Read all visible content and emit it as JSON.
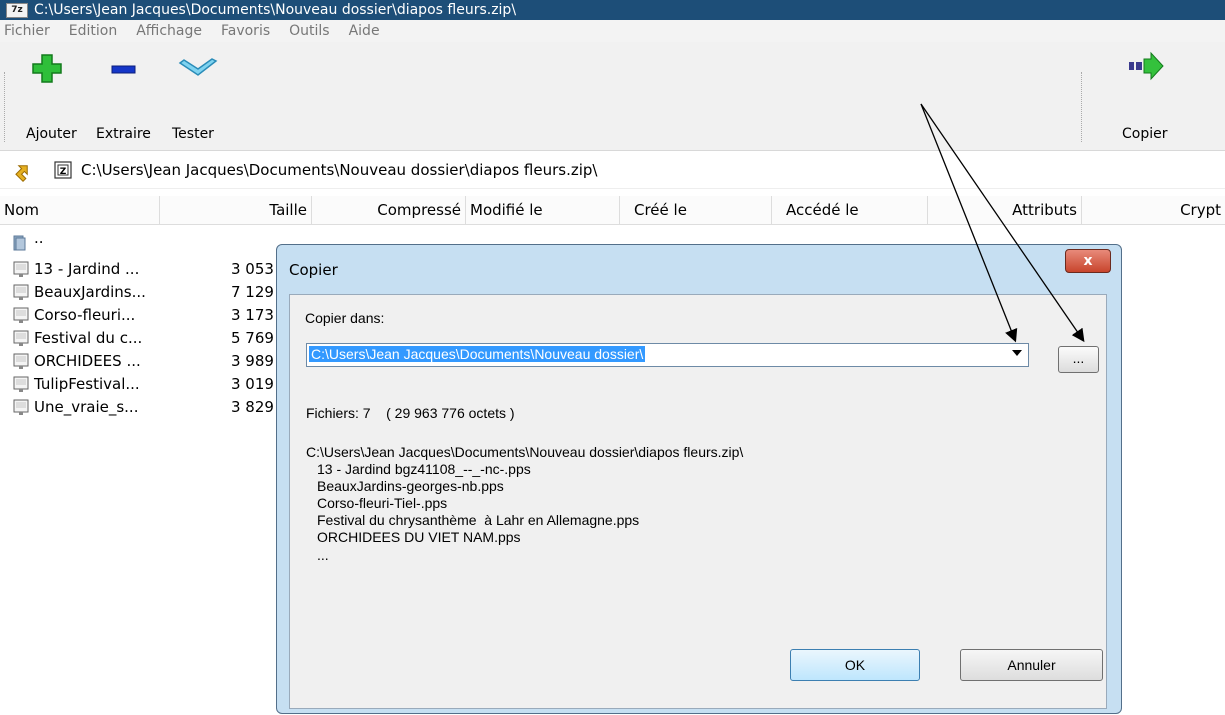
{
  "window": {
    "logo": "7z",
    "title": "C:\\Users\\Jean Jacques\\Documents\\Nouveau dossier\\diapos fleurs.zip\\"
  },
  "menu": [
    "Fichier",
    "Edition",
    "Affichage",
    "Favoris",
    "Outils",
    "Aide"
  ],
  "toolbar": {
    "add_label": "Ajouter",
    "extract_label": "Extraire",
    "test_label": "Tester",
    "copy_label": "Copier"
  },
  "address": {
    "path": "C:\\Users\\Jean Jacques\\Documents\\Nouveau dossier\\diapos fleurs.zip\\"
  },
  "columns": [
    "Nom",
    "Taille",
    "Compressé",
    "Modifié le",
    "Créé le",
    "Accédé le",
    "Attributs",
    "Crypt"
  ],
  "files": [
    {
      "name": "..",
      "size": ""
    },
    {
      "name": "13 - Jardind ...",
      "size": "3 053"
    },
    {
      "name": "BeauxJardins...",
      "size": "7 129"
    },
    {
      "name": "Corso-fleuri...",
      "size": "3 173"
    },
    {
      "name": "Festival du c...",
      "size": "5 769"
    },
    {
      "name": "ORCHIDEES ...",
      "size": "3 989"
    },
    {
      "name": "TulipFestival...",
      "size": "3 019"
    },
    {
      "name": "Une_vraie_s...",
      "size": "3 829"
    }
  ],
  "dialog": {
    "title": "Copier",
    "close_label": "x",
    "copy_to_label": "Copier dans:",
    "destination": "C:\\Users\\Jean Jacques\\Documents\\Nouveau dossier\\",
    "browse_label": "...",
    "files_summary": "Fichiers: 7    ( 29 963 776 octets )",
    "source_path": "C:\\Users\\Jean Jacques\\Documents\\Nouveau dossier\\diapos fleurs.zip\\",
    "items": [
      "13 - Jardind bgz41108_--_-nc-.pps",
      "BeauxJardins-georges-nb.pps",
      "Corso-fleuri-Tiel-.pps",
      "Festival du chrysanthème  à Lahr en Allemagne.pps",
      "ORCHIDEES DU VIET NAM.pps",
      "..."
    ],
    "ok_label": "OK",
    "cancel_label": "Annuler"
  }
}
